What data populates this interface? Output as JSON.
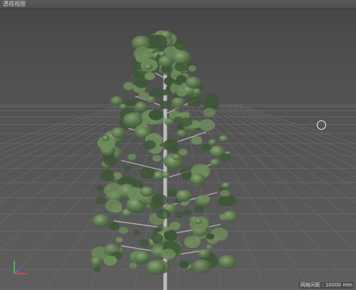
{
  "viewport": {
    "title": "透视视图",
    "grid_spacing_label": "网格间距 : 10000 mm"
  },
  "colors": {
    "background_top": "#4a4a4a",
    "horizon": "#525252",
    "floor": "#5b5b5b",
    "grid_line": "#6e6e6e",
    "foliage_dark": "#3e5638",
    "foliage_mid": "#5c7a4e",
    "foliage_light": "#8ea879",
    "trunk": "#bcbcbc",
    "axis_x": "#e84a4a",
    "axis_y": "#4ad04a",
    "axis_z": "#4a7ae8"
  },
  "icons": {
    "cursor": "orbit-cursor-icon",
    "axis": "xyz-axis-gizmo-icon"
  }
}
